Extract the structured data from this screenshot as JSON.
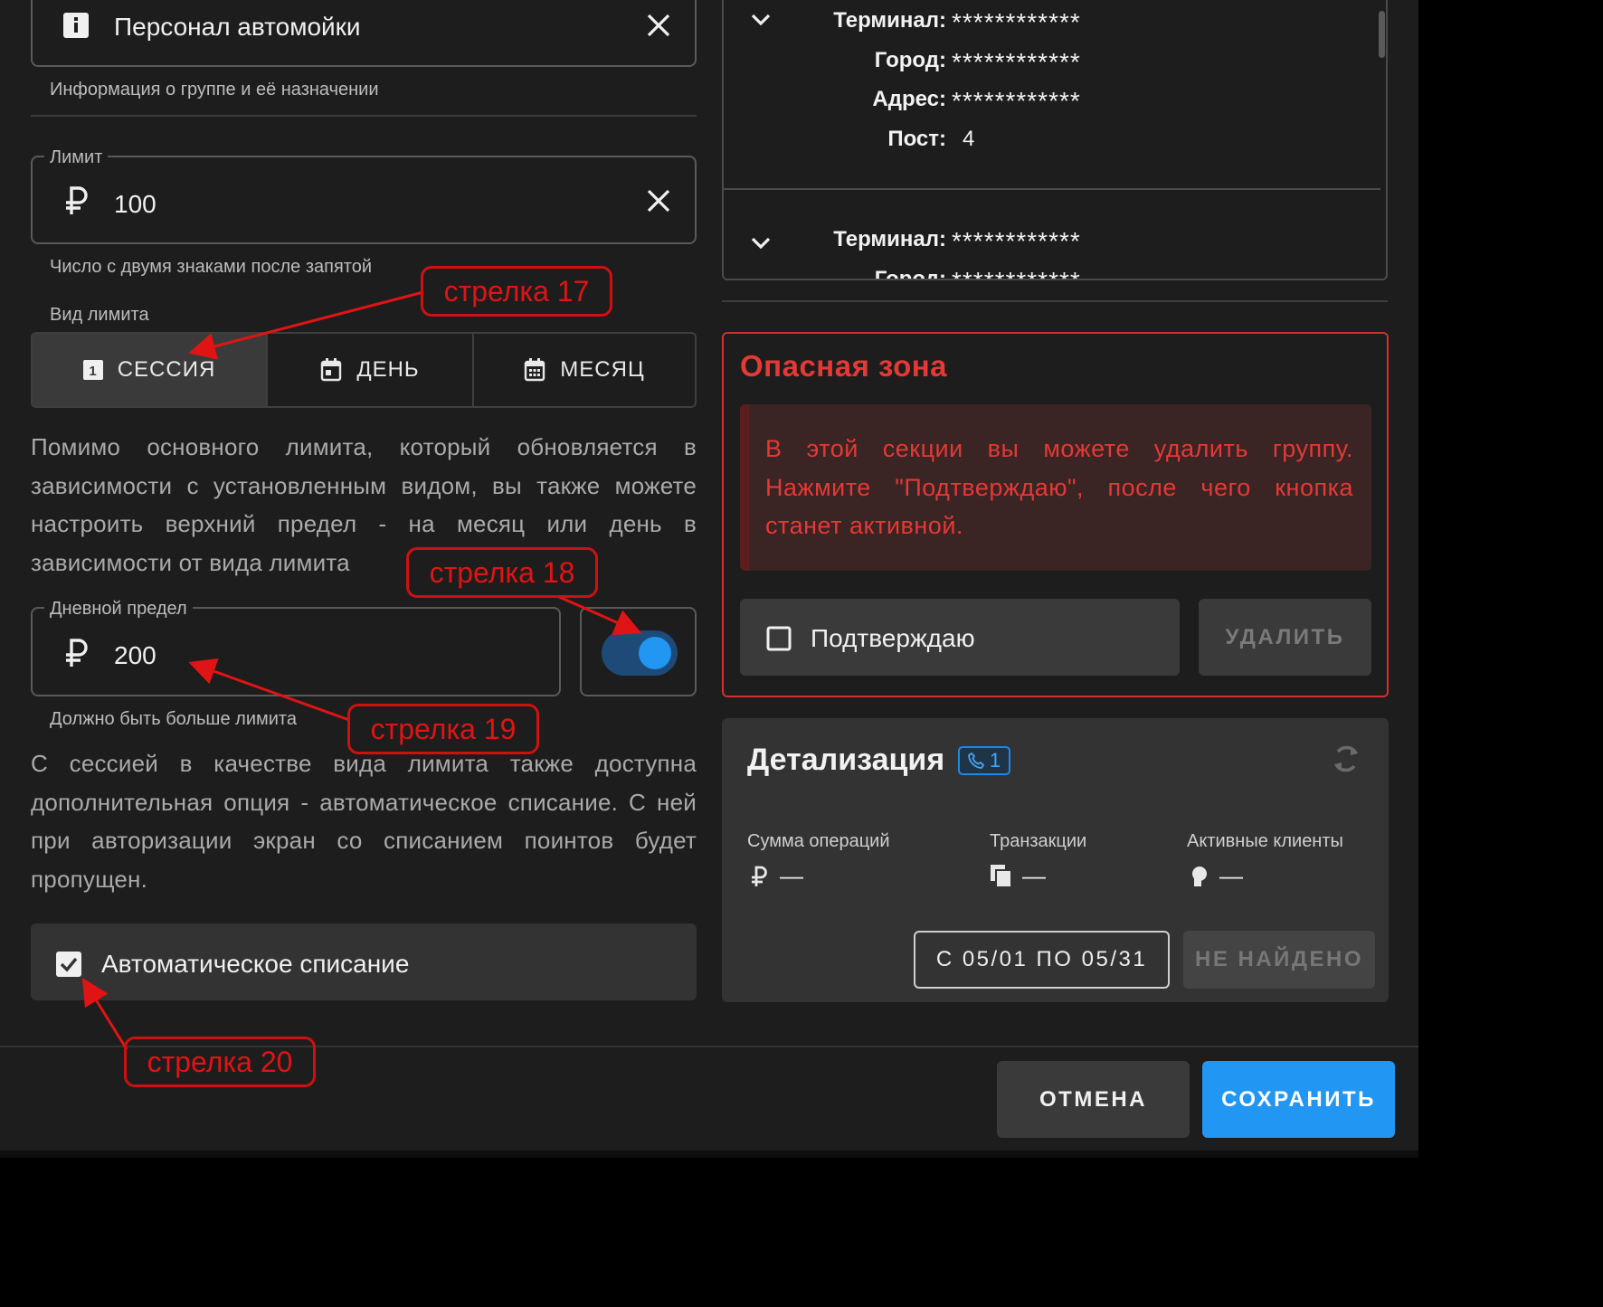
{
  "group_info": {
    "value": "Персонал автомойки",
    "helper": "Информация о группе и её назначении"
  },
  "limit": {
    "label": "Лимит",
    "currency": "₽",
    "value": "100",
    "helper": "Число с двумя знаками после запятой"
  },
  "limit_type": {
    "label": "Вид лимита",
    "options": [
      {
        "label": "СЕССИЯ",
        "selected": true
      },
      {
        "label": "ДЕНЬ",
        "selected": false
      },
      {
        "label": "МЕСЯЦ",
        "selected": false
      }
    ]
  },
  "upper_limit_text": "Помимо основного лимита, который обновляется в зависимости с установленным видом, вы также можете настроить верхний предел - на месяц или день в зависимости от вида лимита",
  "daily_limit": {
    "label": "Дневной предел",
    "currency": "₽",
    "value": "200",
    "helper": "Должно быть больше лимита",
    "enabled": true
  },
  "session_text": "С сессией в качестве вида лимита также доступна дополнительная опция - автоматическое списание. С ней при авторизации экран со списанием поинтов будет пропущен.",
  "auto_debit": {
    "label": "Автоматическое списание",
    "checked": true
  },
  "terminals": [
    {
      "terminal_label": "Терминал:",
      "terminal": "************",
      "city_label": "Город:",
      "city": "************",
      "address_label": "Адрес:",
      "address": "************",
      "post_label": "Пост:",
      "post": "4"
    },
    {
      "terminal_label": "Терминал:",
      "terminal": "************",
      "city_label": "Город:",
      "city": "************"
    }
  ],
  "danger_zone": {
    "title": "Опасная зона",
    "message": "В этой секции вы можете удалить группу. Нажмите \"Подтверждаю\", после чего кнопка станет активной.",
    "confirm_label": "Подтверждаю",
    "confirm_checked": false,
    "delete_label": "УДАЛИТЬ"
  },
  "details": {
    "title": "Детализация",
    "badge": "1",
    "stats": [
      {
        "label": "Сумма операций",
        "icon": "ruble-icon",
        "value": "—"
      },
      {
        "label": "Транзакции",
        "icon": "copy-icon",
        "value": "—"
      },
      {
        "label": "Активные клиенты",
        "icon": "person-icon",
        "value": "—"
      }
    ],
    "date_range": "С 05/01 ПО 05/31",
    "not_found": "НЕ НАЙДЕНО"
  },
  "footer": {
    "cancel": "ОТМЕНА",
    "save": "СОХРАНИТЬ"
  },
  "annotations": [
    "стрелка 17",
    "стрелка 18",
    "стрелка 19",
    "стрелка 20"
  ],
  "colors": {
    "background": "#1d1d1d",
    "accent": "#2196f3",
    "danger": "#d32f2f",
    "annotation": "#e01414"
  }
}
